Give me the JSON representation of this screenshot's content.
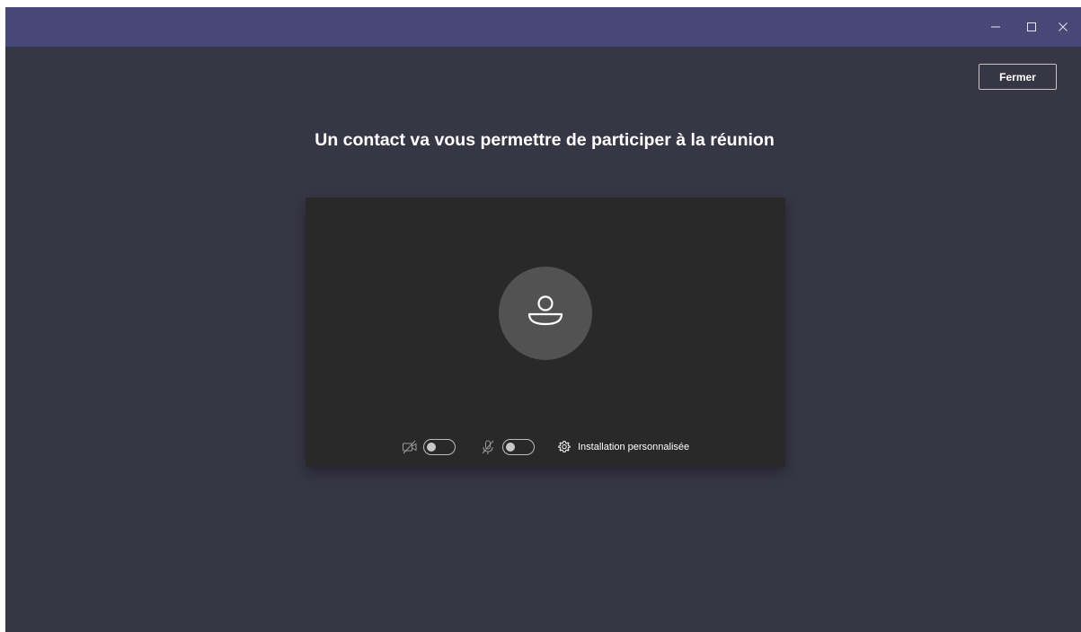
{
  "window": {
    "title_bar_color": "#484878",
    "background_color": "#373645",
    "controls": {
      "minimize_icon": "minimize-icon",
      "maximize_icon": "maximize-icon",
      "close_icon": "close-icon"
    }
  },
  "header": {
    "close_label": "Fermer"
  },
  "main": {
    "heading": "Un contact va vous permettre de participer à la réunion"
  },
  "preview": {
    "background_color": "#292929",
    "avatar_icon": "person-icon",
    "camera": {
      "icon": "camera-off-icon",
      "enabled": false
    },
    "microphone": {
      "icon": "microphone-off-icon",
      "enabled": false
    },
    "custom_setup": {
      "icon": "gear-icon",
      "label": "Installation personnalisée"
    }
  }
}
